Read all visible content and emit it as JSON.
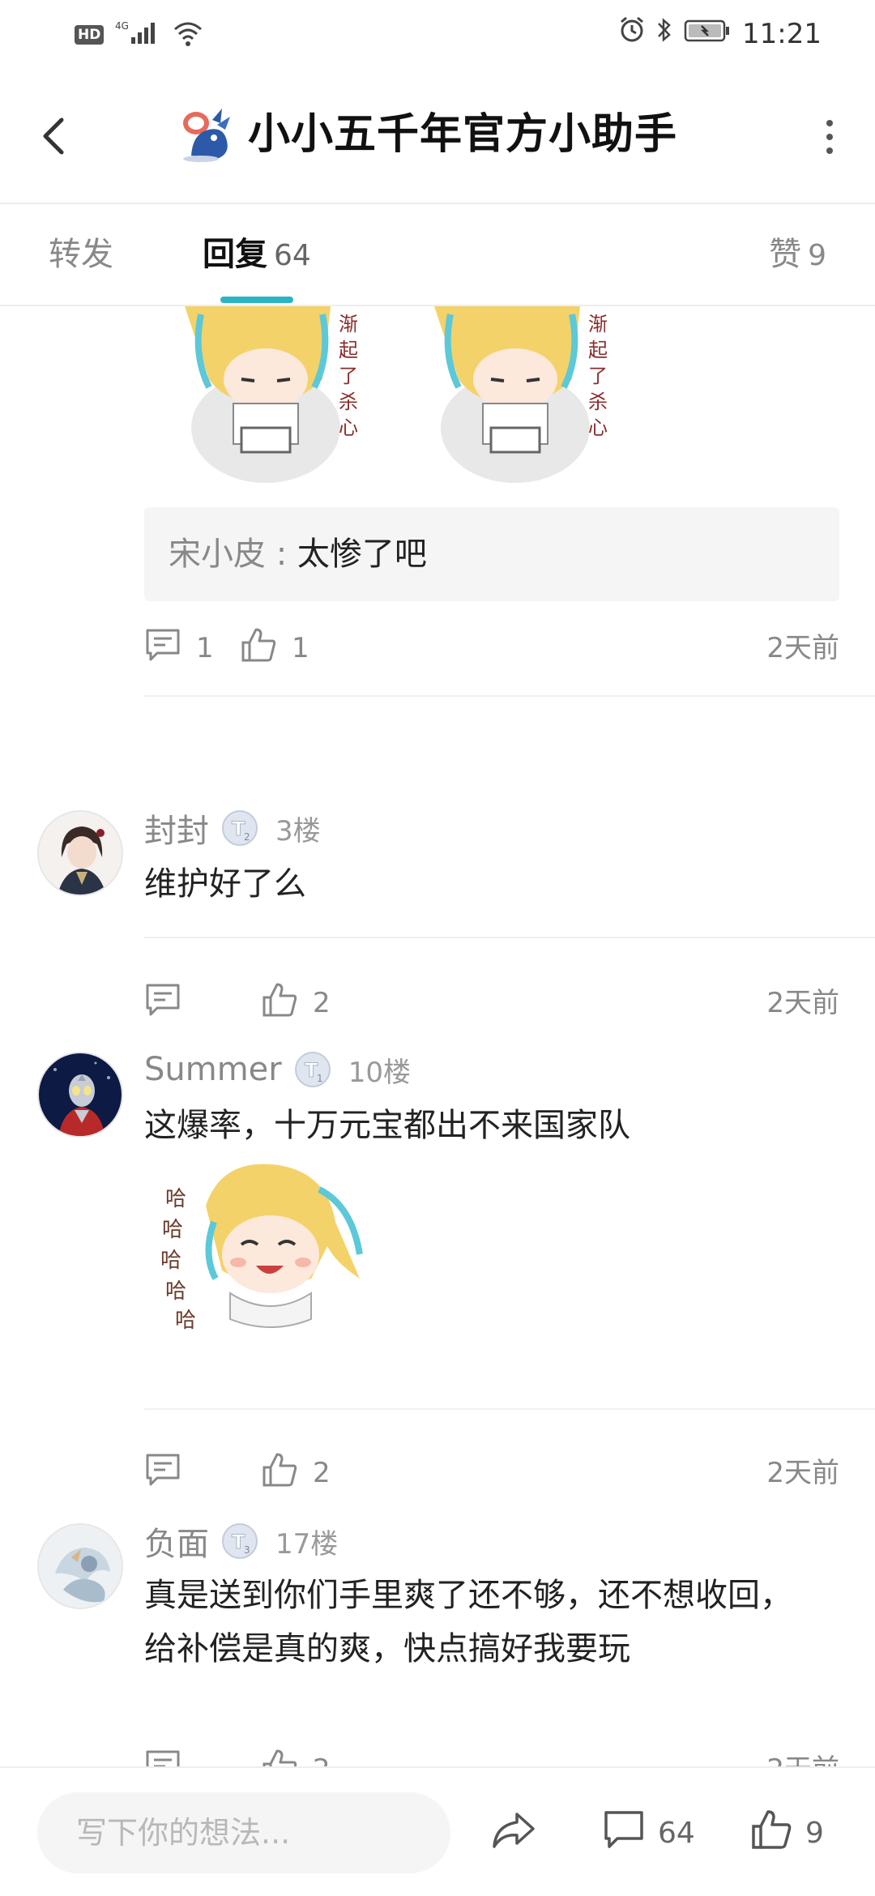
{
  "status_bar": {
    "hd_label": "HD",
    "network": "4G",
    "time": "11:21",
    "icons": [
      "signal-icon",
      "wifi-icon",
      "alarm-icon",
      "bluetooth-icon",
      "battery-icon"
    ]
  },
  "header": {
    "title": "小小五千年官方小助手",
    "icons": [
      "back-icon",
      "logo-icon",
      "more-icon"
    ]
  },
  "tabs": [
    {
      "label": "转发",
      "count": ""
    },
    {
      "label": "回复",
      "count": "64"
    },
    {
      "label": "赞",
      "count": "9"
    }
  ],
  "colors": {
    "accent": "#2bb3c6",
    "muted": "#888888",
    "text": "#222222"
  },
  "top_reply": {
    "quote_name": "宋小皮",
    "quote_sep": " : ",
    "quote_text": "太惨了吧",
    "comments": "1",
    "likes": "1",
    "time": "2天前"
  },
  "comments": [
    {
      "user": "封封",
      "badge": "T2",
      "floor": "3楼",
      "text": "维护好了么",
      "likes": "2",
      "time": "2天前"
    },
    {
      "user": "Summer",
      "badge": "T1",
      "floor": "10楼",
      "text": "这爆率，十万元宝都出不来国家队",
      "likes": "2",
      "time": "2天前"
    },
    {
      "user": "负面",
      "badge": "T3",
      "floor": "17楼",
      "text_line1": "真是送到你们手里爽了还不够，还不想收回，",
      "text_line2": "给补偿是真的爽，快点搞好我要玩",
      "likes": "2",
      "time": "2天前"
    }
  ],
  "bottom_bar": {
    "placeholder": "写下你的想法...",
    "comment_count": "64",
    "like_count": "9"
  }
}
